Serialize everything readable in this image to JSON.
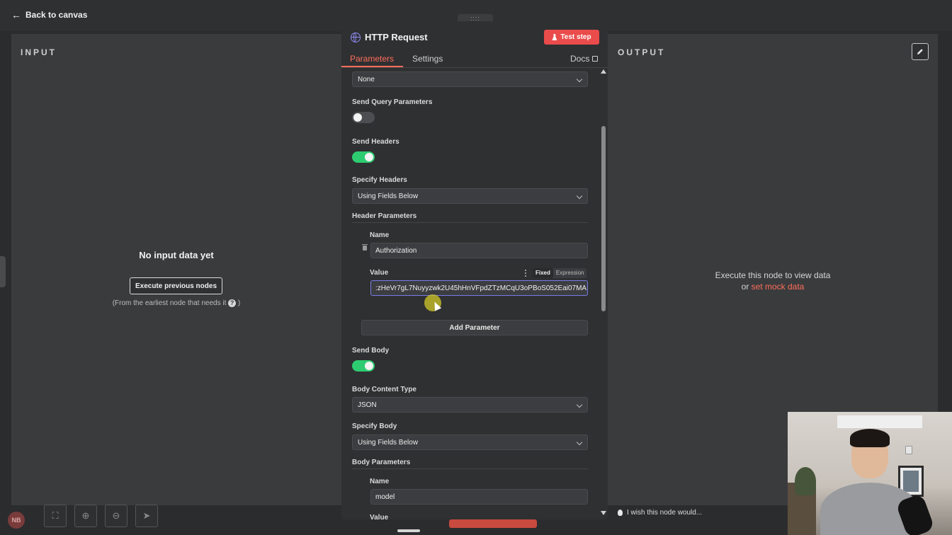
{
  "topbar": {
    "back_label": "Back to canvas"
  },
  "input_pane": {
    "title": "INPUT",
    "empty_title": "No input data yet",
    "execute_button": "Execute previous nodes",
    "hint": "(From the earliest node that needs it",
    "hint_end": ")"
  },
  "output_pane": {
    "title": "OUTPUT",
    "execute_text": "Execute this node to view data",
    "or_text": "or",
    "mock_link": "set mock data",
    "wish_text": "I wish this node would..."
  },
  "node": {
    "title": "HTTP Request",
    "test_step": "Test step",
    "tabs": [
      {
        "label": "Parameters",
        "active": true
      },
      {
        "label": "Settings",
        "active": false
      }
    ],
    "docs_label": "Docs"
  },
  "params": {
    "auth_select": "None",
    "send_query_label": "Send Query Parameters",
    "send_query_on": false,
    "send_headers_label": "Send Headers",
    "send_headers_on": true,
    "specify_headers_label": "Specify Headers",
    "specify_headers_value": "Using Fields Below",
    "header_params_label": "Header Parameters",
    "header_name_label": "Name",
    "header_name_value": "Authorization",
    "header_value_label": "Value",
    "value_mode_fixed": "Fixed",
    "value_mode_expression": "Expression",
    "header_value_value": ":zHeVr7gL7Nuyyzwk2U45hHnVFpdZTzMCqU3oPBoS052Eai07MA",
    "add_parameter": "Add Parameter",
    "send_body_label": "Send Body",
    "send_body_on": true,
    "body_content_type_label": "Body Content Type",
    "body_content_type_value": "JSON",
    "specify_body_label": "Specify Body",
    "specify_body_value": "Using Fields Below",
    "body_params_label": "Body Parameters",
    "body_name_label": "Name",
    "body_name_value": "model",
    "body_value_label": "Value"
  },
  "bottom": {
    "avatar_initials": "NB"
  },
  "colors": {
    "accent": "#ff6d5a",
    "toggle_on": "#2ecc71",
    "test_step": "#ea4b4b",
    "focus": "#7a7ce8"
  },
  "icons": [
    "arrow-left-icon",
    "globe-icon",
    "flask-icon",
    "external-link-icon",
    "chevron-down-icon",
    "trash-icon",
    "kebab-icon",
    "question-icon",
    "pencil-icon",
    "bulb-icon",
    "fit-view-icon",
    "zoom-in-icon",
    "zoom-out-icon",
    "pointer-icon"
  ]
}
